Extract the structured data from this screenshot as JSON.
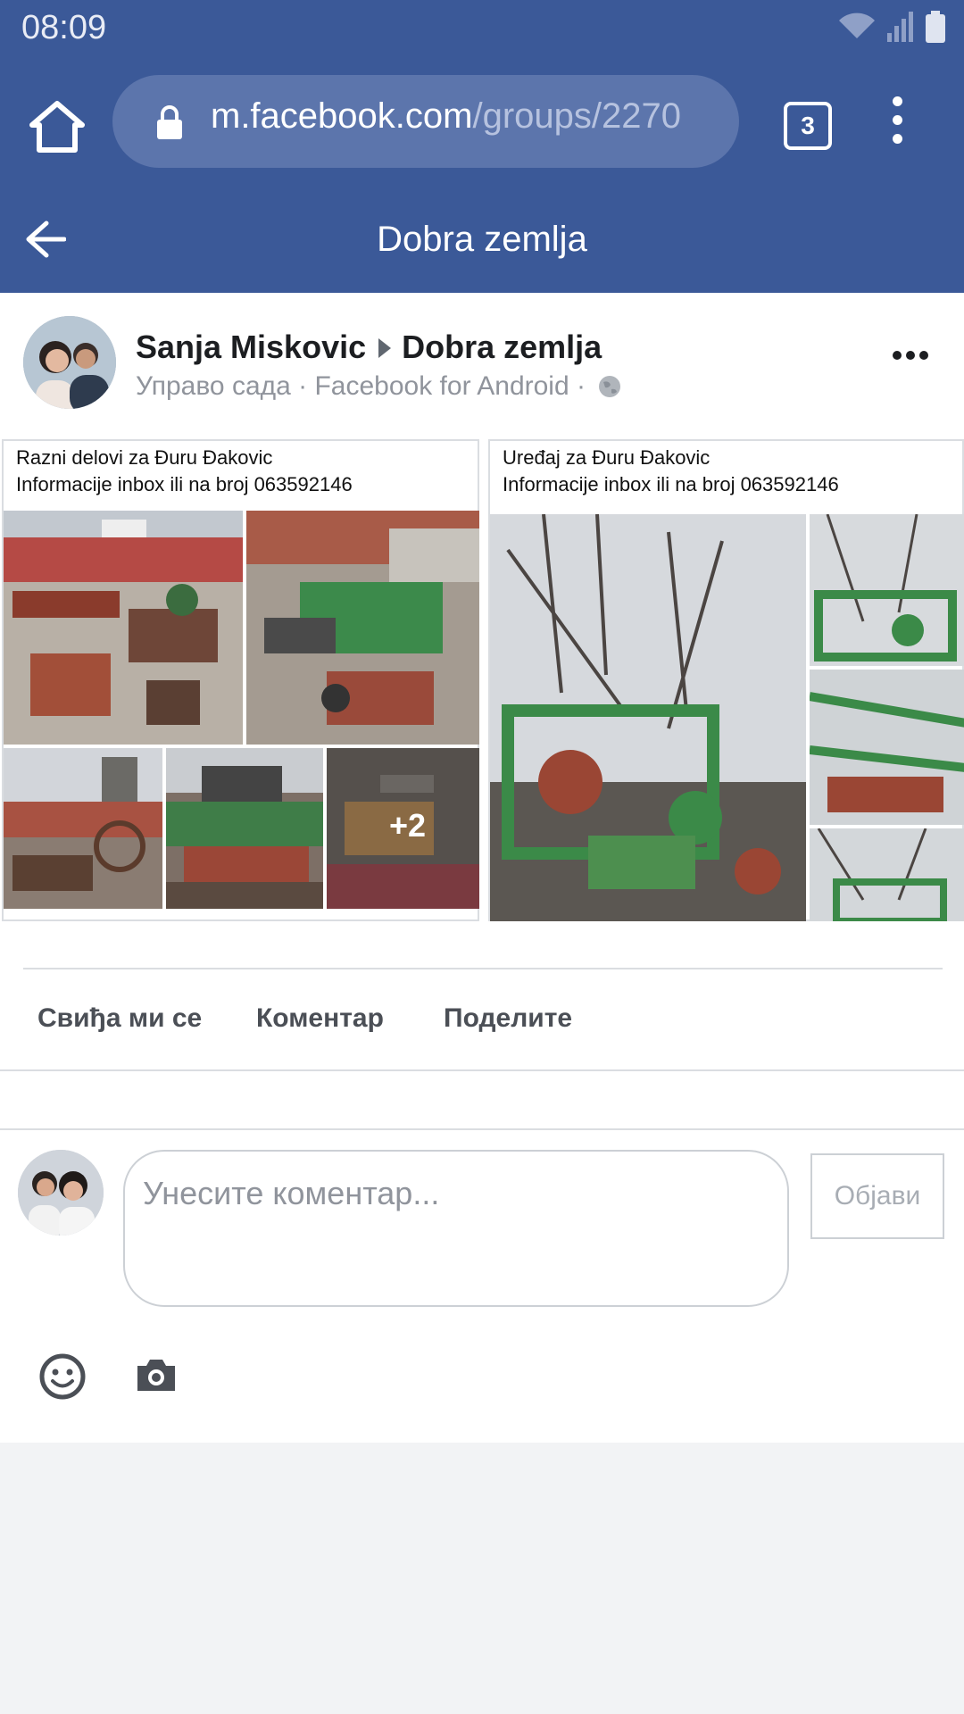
{
  "status_bar": {
    "time": "08:09"
  },
  "browser": {
    "url_host": "m.facebook.com",
    "url_path": "/groups/2270",
    "tab_count": "3"
  },
  "header": {
    "title": "Dobra zemlja"
  },
  "post": {
    "author": "Sanja Miskovic",
    "group": "Dobra zemlja",
    "meta": "Управо сада · Facebook for Android ·",
    "photos": [
      {
        "caption_line1": "Razni delovi za Đuru Đakovic",
        "caption_line2": "Informacije inbox ili na broj 063592146",
        "more_count": "+2"
      },
      {
        "caption_line1": "Uređaj za Đuru Đakovic",
        "caption_line2": "Informacije inbox ili na broj 063592146"
      }
    ],
    "actions": {
      "like": "Свиђа ми се",
      "comment": "Коментар",
      "share": "Поделите"
    }
  },
  "composer": {
    "placeholder": "Унесите коментар...",
    "post_label": "Објави"
  },
  "colors": {
    "brand": "#3b5998",
    "pill": "#5c75ac"
  }
}
